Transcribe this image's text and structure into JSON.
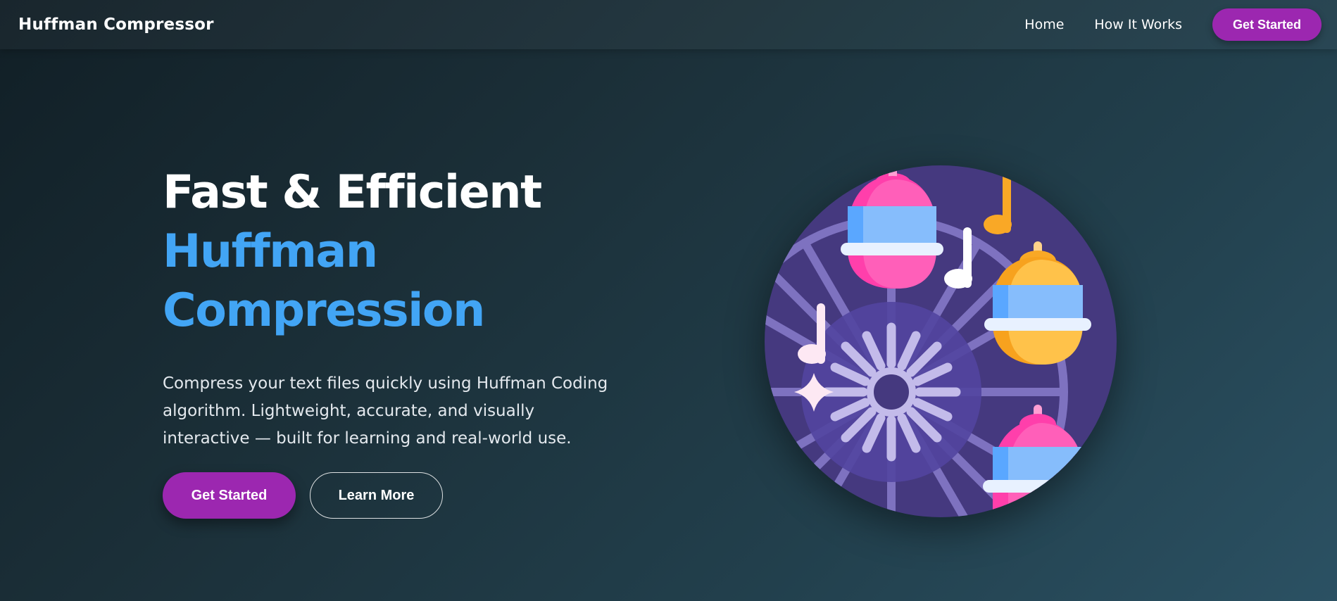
{
  "navbar": {
    "brand": "Huffman Compressor",
    "links": [
      {
        "label": "Home"
      },
      {
        "label": "How It Works"
      }
    ],
    "cta_label": "Get Started"
  },
  "hero": {
    "headline_line1": "Fast & Efficient",
    "headline_line2": "Huffman",
    "headline_line3": "Compression",
    "description": "Compress your text files quickly using Huffman Coding algorithm. Lightweight, accurate, and visually interactive — built for learning and real-world use.",
    "primary_button": "Get Started",
    "secondary_button": "Learn More"
  },
  "colors": {
    "accent_blue": "#42a5f5",
    "button_purple": "#9c27b0",
    "illustration_circle": "#45397f"
  },
  "illustration": {
    "icon": "ferris-wheel-music-icon"
  }
}
